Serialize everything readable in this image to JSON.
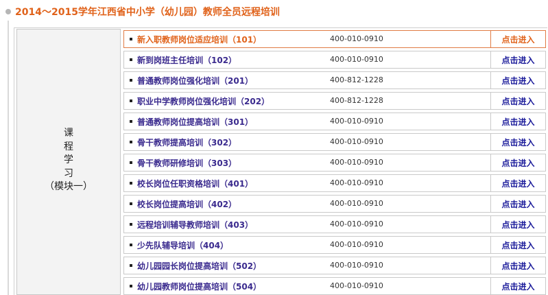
{
  "page": {
    "title": "2014～2015学年江西省中小学（幼儿园）教师全员远程培训"
  },
  "module": {
    "label_lines": [
      "课",
      "程",
      "学",
      "习",
      "（模块一）"
    ]
  },
  "courses": [
    {
      "name": "新入职教师岗位适应培训（101）",
      "phone": "400-010-0910",
      "action": "点击进入"
    },
    {
      "name": "新到岗班主任培训（102）",
      "phone": "400-010-0910",
      "action": "点击进入"
    },
    {
      "name": "普通教师岗位强化培训（201）",
      "phone": "400-812-1228",
      "action": "点击进入"
    },
    {
      "name": "职业中学教师岗位强化培训（202）",
      "phone": "400-812-1228",
      "action": "点击进入"
    },
    {
      "name": "普通教师岗位提高培训（301）",
      "phone": "400-010-0910",
      "action": "点击进入"
    },
    {
      "name": "骨干教师提高培训（302）",
      "phone": "400-010-0910",
      "action": "点击进入"
    },
    {
      "name": "骨干教师研修培训（303）",
      "phone": "400-010-0910",
      "action": "点击进入"
    },
    {
      "name": "校长岗位任职资格培训（401）",
      "phone": "400-010-0910",
      "action": "点击进入"
    },
    {
      "name": "校长岗位提高培训（402）",
      "phone": "400-010-0910",
      "action": "点击进入"
    },
    {
      "name": "远程培训辅导教师培训（403）",
      "phone": "400-010-0910",
      "action": "点击进入"
    },
    {
      "name": "少先队辅导培训（404）",
      "phone": "400-010-0910",
      "action": "点击进入"
    },
    {
      "name": "幼儿园园长岗位提高培训（502）",
      "phone": "400-010-0910",
      "action": "点击进入"
    },
    {
      "name": "幼儿园教师岗位提高培训（504）",
      "phone": "400-010-0910",
      "action": "点击进入"
    }
  ],
  "colors": {
    "title": "#e0621a",
    "course_link": "#3a2a8e",
    "active_border": "#e07a43"
  }
}
